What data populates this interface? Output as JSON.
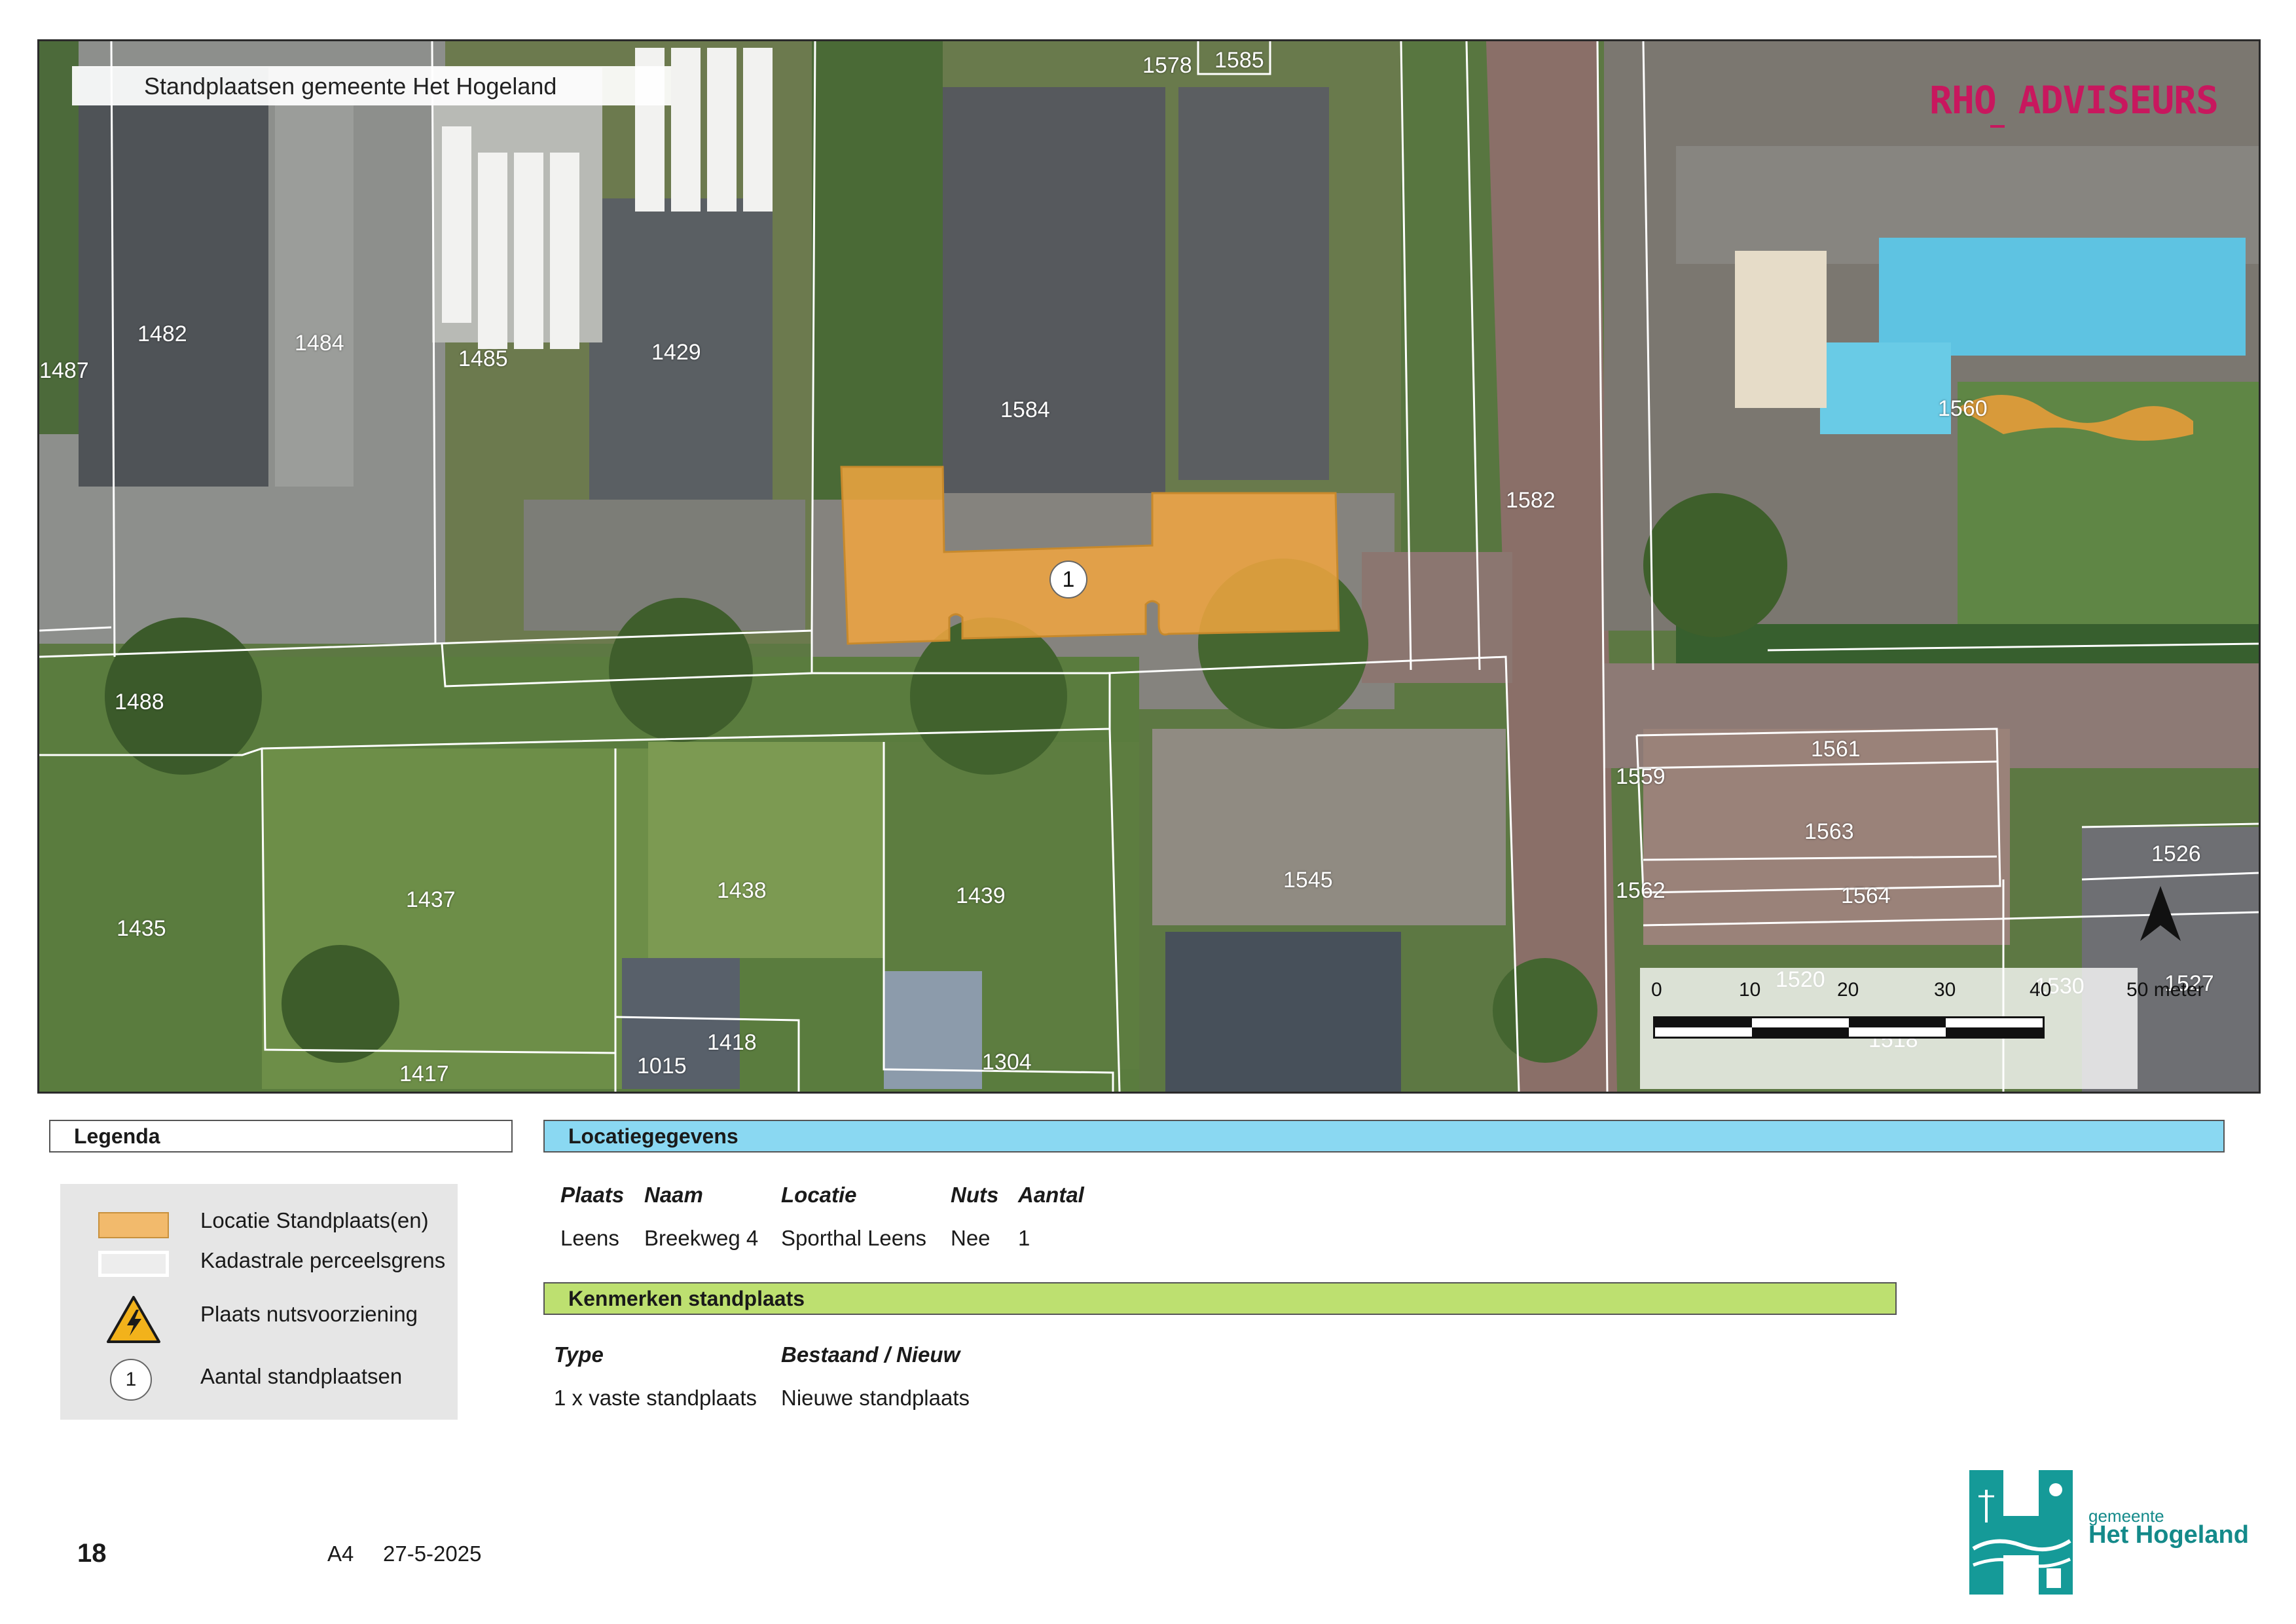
{
  "map": {
    "title": "Standplaatsen gemeente Het Hogeland",
    "brand": "RHO ADVISEURS",
    "brand_color": "#c8175e",
    "location_marker": "1",
    "parcels": [
      "1578",
      "1585",
      "1482",
      "1484",
      "1487",
      "1485",
      "1429",
      "1584",
      "1582",
      "1560",
      "1488",
      "1437",
      "1435",
      "1438",
      "1439",
      "1545",
      "1559",
      "1561",
      "1563",
      "1562",
      "1564",
      "1526",
      "1520",
      "1530",
      "1527",
      "1518",
      "1417",
      "1015",
      "1418",
      "1304"
    ],
    "north_arrow": "north-arrow-icon",
    "scale": {
      "ticks": [
        "0",
        "10",
        "20",
        "30",
        "40",
        "50 meter"
      ]
    }
  },
  "legend": {
    "title": "Legenda",
    "items": [
      {
        "label": "Locatie Standplaats(en)",
        "color": "#f2ba6c"
      },
      {
        "label": "Kadastrale perceelsgrens",
        "color": "#ffffff"
      },
      {
        "label": "Plaats nutsvoorziening",
        "icon": "hazard-icon"
      },
      {
        "label": "Aantal standplaatsen",
        "symbol": "1"
      }
    ]
  },
  "location": {
    "title": "Locatiegegevens",
    "color": "#8ad8f2",
    "headers": [
      "Plaats",
      "Naam",
      "Locatie",
      "Nuts",
      "Aantal"
    ],
    "row": [
      "Leens",
      "Breekweg 4",
      "Sporthal Leens",
      "Nee",
      "1"
    ]
  },
  "features": {
    "title": "Kenmerken standplaats",
    "color": "#bde070",
    "headers": [
      "Type",
      "Bestaand / Nieuw"
    ],
    "row": [
      "1 x vaste standplaats",
      "Nieuwe standplaats"
    ]
  },
  "footer": {
    "page_number": "18",
    "paper_size": "A4",
    "date": "27-5-2025"
  },
  "municipality": {
    "small": "gemeente",
    "name": "Het Hogeland",
    "color": "#148a8a"
  }
}
